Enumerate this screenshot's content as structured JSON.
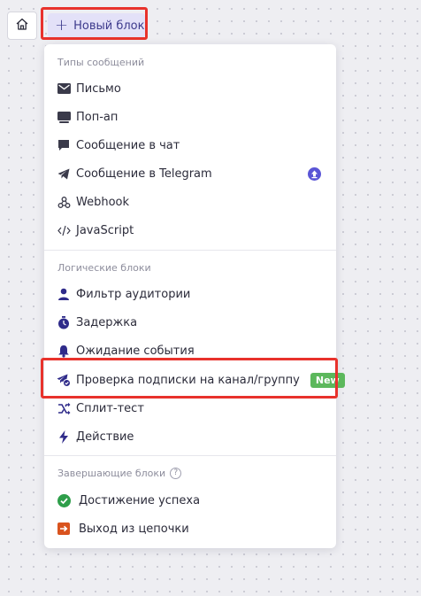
{
  "toolbar": {
    "new_block_label": "Новый блок",
    "plus_symbol": "+",
    "home_icon": "home-icon"
  },
  "menu": {
    "sections": [
      {
        "title": "Типы сообщений",
        "items": [
          {
            "label": "Письмо",
            "icon": "envelope-icon"
          },
          {
            "label": "Поп-ап",
            "icon": "popup-icon"
          },
          {
            "label": "Сообщение в чат",
            "icon": "chat-bubble-icon"
          },
          {
            "label": "Сообщение в Telegram",
            "icon": "telegram-icon",
            "badge_icon": "upload-badge-icon"
          },
          {
            "label": "Webhook",
            "icon": "webhook-icon"
          },
          {
            "label": "JavaScript",
            "icon": "code-icon"
          }
        ]
      },
      {
        "title": "Логические блоки",
        "items": [
          {
            "label": "Фильтр аудитории",
            "icon": "user-icon"
          },
          {
            "label": "Задержка",
            "icon": "stopwatch-icon"
          },
          {
            "label": "Ожидание события",
            "icon": "bell-icon"
          },
          {
            "label": "Проверка подписки на канал/группу",
            "icon": "telegram-check-icon",
            "badge": "New"
          },
          {
            "label": "Сплит-тест",
            "icon": "split-icon"
          },
          {
            "label": "Действие",
            "icon": "lightning-icon"
          }
        ]
      },
      {
        "title": "Завершающие блоки",
        "help_icon": "?",
        "items": [
          {
            "label": "Достижение успеха",
            "icon": "success-check-icon"
          },
          {
            "label": "Выход из цепочки",
            "icon": "exit-icon"
          }
        ]
      }
    ]
  },
  "colors": {
    "accent": "#3d3a8c",
    "icon": "#2f2b8a",
    "success": "#2e9e4a",
    "exit": "#e05a1a",
    "new_badge": "#5cb85c",
    "highlight": "#e8322c"
  }
}
